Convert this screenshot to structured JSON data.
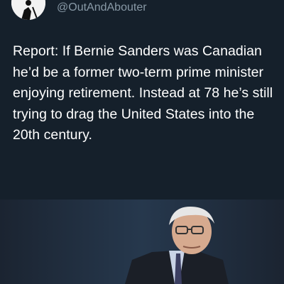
{
  "tweet": {
    "handle": "@OutAndAbouter",
    "text": "Report: If Bernie Sanders was Canadian he’d be a former two-term prime minister enjoying retirement. Instead at 78 he’s still trying to drag the United States into the 20th century."
  },
  "icons": [
    "avatar-hiker-icon"
  ],
  "colors": {
    "background": "#15202b",
    "handle": "#8899a6",
    "text": "#ffffff"
  }
}
